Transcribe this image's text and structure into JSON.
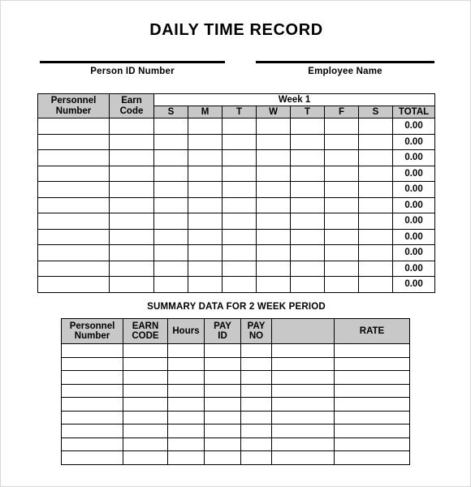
{
  "document": {
    "title": "DAILY TIME RECORD"
  },
  "identity_fields": [
    {
      "name": "person-id-number",
      "label": "Person ID Number",
      "value": ""
    },
    {
      "name": "employee-name",
      "label": "Employee Name",
      "value": ""
    }
  ],
  "main_table": {
    "group_header": {
      "week_label": "Week 1"
    },
    "columns": [
      {
        "key": "personnel_number",
        "label_line1": "Personnel",
        "label_line2": "Number"
      },
      {
        "key": "earn_code",
        "label_line1": "Earn",
        "label_line2": "Code"
      }
    ],
    "day_columns": [
      "S",
      "M",
      "T",
      "W",
      "T",
      "F",
      "S"
    ],
    "total_column": "TOTAL",
    "row_count": 11,
    "default_total": "0.00",
    "rows": [
      {
        "personnel_number": "",
        "earn_code": "",
        "days": [
          "",
          "",
          "",
          "",
          "",
          "",
          ""
        ],
        "total": "0.00"
      },
      {
        "personnel_number": "",
        "earn_code": "",
        "days": [
          "",
          "",
          "",
          "",
          "",
          "",
          ""
        ],
        "total": "0.00"
      },
      {
        "personnel_number": "",
        "earn_code": "",
        "days": [
          "",
          "",
          "",
          "",
          "",
          "",
          ""
        ],
        "total": "0.00"
      },
      {
        "personnel_number": "",
        "earn_code": "",
        "days": [
          "",
          "",
          "",
          "",
          "",
          "",
          ""
        ],
        "total": "0.00"
      },
      {
        "personnel_number": "",
        "earn_code": "",
        "days": [
          "",
          "",
          "",
          "",
          "",
          "",
          ""
        ],
        "total": "0.00"
      },
      {
        "personnel_number": "",
        "earn_code": "",
        "days": [
          "",
          "",
          "",
          "",
          "",
          "",
          ""
        ],
        "total": "0.00"
      },
      {
        "personnel_number": "",
        "earn_code": "",
        "days": [
          "",
          "",
          "",
          "",
          "",
          "",
          ""
        ],
        "total": "0.00"
      },
      {
        "personnel_number": "",
        "earn_code": "",
        "days": [
          "",
          "",
          "",
          "",
          "",
          "",
          ""
        ],
        "total": "0.00"
      },
      {
        "personnel_number": "",
        "earn_code": "",
        "days": [
          "",
          "",
          "",
          "",
          "",
          "",
          ""
        ],
        "total": "0.00"
      },
      {
        "personnel_number": "",
        "earn_code": "",
        "days": [
          "",
          "",
          "",
          "",
          "",
          "",
          ""
        ],
        "total": "0.00"
      },
      {
        "personnel_number": "",
        "earn_code": "",
        "days": [
          "",
          "",
          "",
          "",
          "",
          "",
          ""
        ],
        "total": "0.00"
      }
    ]
  },
  "summary_section": {
    "heading": "SUMMARY DATA FOR 2 WEEK PERIOD",
    "columns": [
      {
        "key": "personnel_number",
        "label_line1": "Personnel",
        "label_line2": "Number"
      },
      {
        "key": "earn_code",
        "label_line1": "EARN",
        "label_line2": "CODE"
      },
      {
        "key": "hours",
        "label_line1": "",
        "label_line2": "Hours"
      },
      {
        "key": "pay_id",
        "label_line1": "PAY",
        "label_line2": "ID"
      },
      {
        "key": "pay_no",
        "label_line1": "PAY",
        "label_line2": "NO"
      },
      {
        "key": "blank",
        "label_line1": "",
        "label_line2": ""
      },
      {
        "key": "rate",
        "label_line1": "",
        "label_line2": "RATE"
      }
    ],
    "row_count": 9,
    "rows": [
      {
        "personnel_number": "",
        "earn_code": "",
        "hours": "",
        "pay_id": "",
        "pay_no": "",
        "blank": "",
        "rate": ""
      },
      {
        "personnel_number": "",
        "earn_code": "",
        "hours": "",
        "pay_id": "",
        "pay_no": "",
        "blank": "",
        "rate": ""
      },
      {
        "personnel_number": "",
        "earn_code": "",
        "hours": "",
        "pay_id": "",
        "pay_no": "",
        "blank": "",
        "rate": ""
      },
      {
        "personnel_number": "",
        "earn_code": "",
        "hours": "",
        "pay_id": "",
        "pay_no": "",
        "blank": "",
        "rate": ""
      },
      {
        "personnel_number": "",
        "earn_code": "",
        "hours": "",
        "pay_id": "",
        "pay_no": "",
        "blank": "",
        "rate": ""
      },
      {
        "personnel_number": "",
        "earn_code": "",
        "hours": "",
        "pay_id": "",
        "pay_no": "",
        "blank": "",
        "rate": ""
      },
      {
        "personnel_number": "",
        "earn_code": "",
        "hours": "",
        "pay_id": "",
        "pay_no": "",
        "blank": "",
        "rate": ""
      },
      {
        "personnel_number": "",
        "earn_code": "",
        "hours": "",
        "pay_id": "",
        "pay_no": "",
        "blank": "",
        "rate": ""
      },
      {
        "personnel_number": "",
        "earn_code": "",
        "hours": "",
        "pay_id": "",
        "pay_no": "",
        "blank": "",
        "rate": ""
      }
    ]
  },
  "style": {
    "header_fill": "#c8c8c8",
    "border_color": "#000000",
    "page_background": "#ffffff",
    "text_color": "#000000"
  }
}
